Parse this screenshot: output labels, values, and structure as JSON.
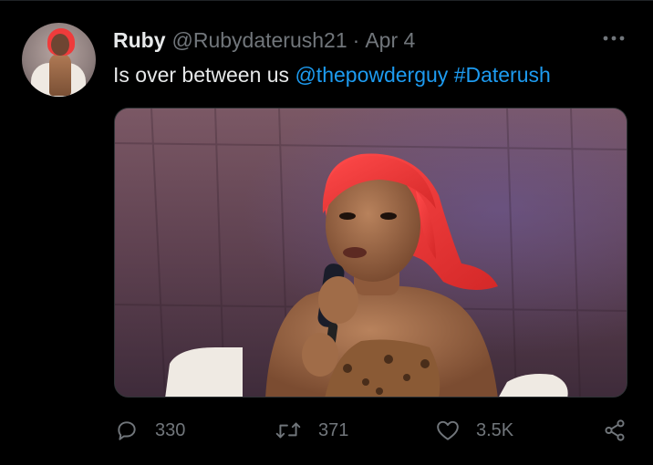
{
  "tweet": {
    "author_name": "Ruby",
    "handle": "@Rubydaterush21",
    "separator": "·",
    "date": "Apr 4",
    "text_main": "Is over between us",
    "mention": "@thepowderguy",
    "hashtag": "#Daterush"
  },
  "actions": {
    "reply_count": "330",
    "retweet_count": "371",
    "like_count": "3.5K"
  },
  "colors": {
    "background": "#000000",
    "primary_text": "#e7e9ea",
    "secondary_text": "#71767b",
    "link": "#1d9bf0"
  },
  "icons": [
    "more-icon",
    "reply-icon",
    "retweet-icon",
    "like-icon",
    "share-icon"
  ]
}
